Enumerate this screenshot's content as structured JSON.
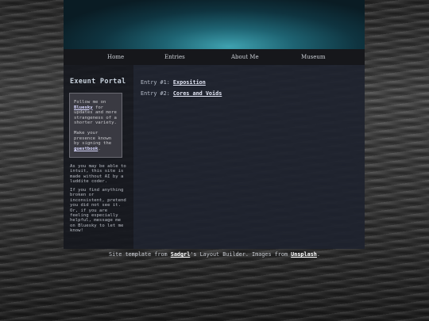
{
  "nav": {
    "items": [
      "Home",
      "Entries",
      "About Me",
      "Museum"
    ]
  },
  "sidebar": {
    "title": "Exeunt Portal",
    "info_box": {
      "p1_pre": "Follow me on ",
      "p1_link": "Bluesky",
      "p1_post": " for updates and more strangeness of a shorter variety.",
      "p2_pre": "Make your presence known by signing the ",
      "p2_link": "guestbook",
      "p2_post": "."
    },
    "note1": "As you may be able to intuit, this site is made without AI by a luddite coder.",
    "note2": "If you find anything broken or inconsistent, pretend you did not see it. Or, if you are feeling especially helpful, message me on Bluesky to let me know!"
  },
  "main": {
    "entries": [
      {
        "prefix": "Entry #1: ",
        "title": "Exposition"
      },
      {
        "prefix": "Entry #2: ",
        "title": "Cores and Voids"
      }
    ]
  },
  "footer": {
    "pre": "Site template from ",
    "link1": "Sadgrl",
    "mid": "'s Layout Builder. Images from ",
    "link2": "Unsplash",
    "post": "."
  },
  "colors": {
    "banner_accent": "#3fa2b0",
    "nav_bg": "#16171b",
    "sidebar_bg": "#16181e",
    "main_bg": "#1e222e"
  }
}
